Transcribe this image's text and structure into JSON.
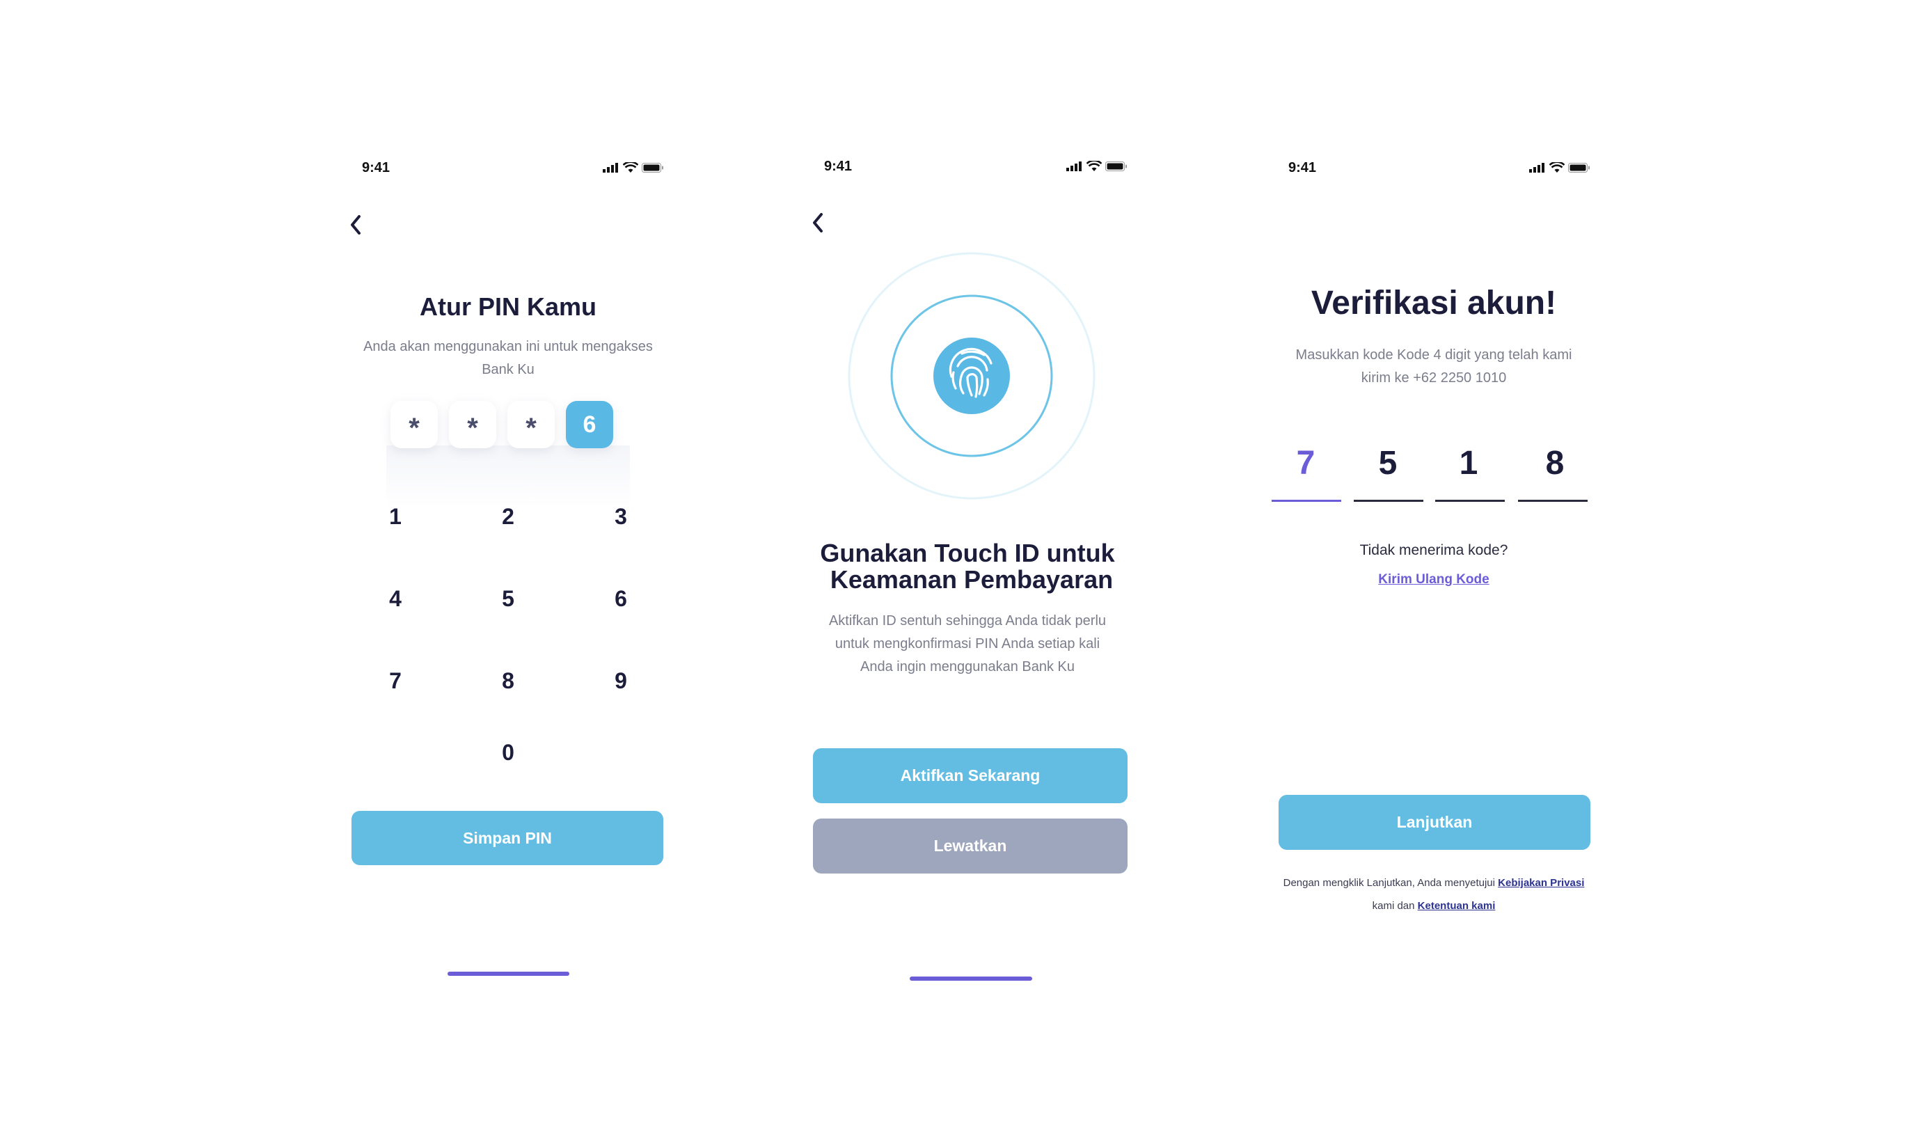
{
  "status_bar": {
    "time": "9:41"
  },
  "screen_pin": {
    "title": "Atur PIN Kamu",
    "subtitle_line1": "Anda akan menggunakan ini untuk mengakses",
    "subtitle_line2": "Bank Ku",
    "pin_digits": [
      "*",
      "*",
      "*",
      "6"
    ],
    "keypad": [
      "1",
      "2",
      "3",
      "4",
      "5",
      "6",
      "7",
      "8",
      "9",
      "0"
    ],
    "save_button": "Simpan PIN"
  },
  "screen_touch": {
    "title_line1": "Gunakan Touch ID untuk",
    "title_line2": "Keamanan Pembayaran",
    "desc_line1": "Aktifkan ID sentuh sehingga Anda tidak perlu",
    "desc_line2": "untuk mengkonfirmasi PIN Anda setiap kali",
    "desc_line3": "Anda ingin menggunakan Bank Ku",
    "activate_button": "Aktifkan Sekarang",
    "skip_button": "Lewatkan"
  },
  "screen_verify": {
    "title": "Verifikasi akun!",
    "subtitle_line1": "Masukkan kode Kode 4 digit yang telah kami",
    "subtitle_line2": "kirim ke +62 2250 1010",
    "otp": [
      "7",
      "5",
      "1",
      "8"
    ],
    "no_code_text": "Tidak menerima kode?",
    "resend_link": "Kirim Ulang Kode",
    "continue_button": "Lanjutkan",
    "terms_prefix": "Dengan mengklik Lanjutkan, Anda menyetujui",
    "privacy_link": "Kebijakan Privasi",
    "terms_middle": "kami dan",
    "terms_link": "Ketentuan kami"
  },
  "colors": {
    "accent_blue": "#63bde3",
    "accent_purple": "#6b5cd8",
    "button_gray": "#9ea6be",
    "text_dark": "#1c1c3b"
  }
}
